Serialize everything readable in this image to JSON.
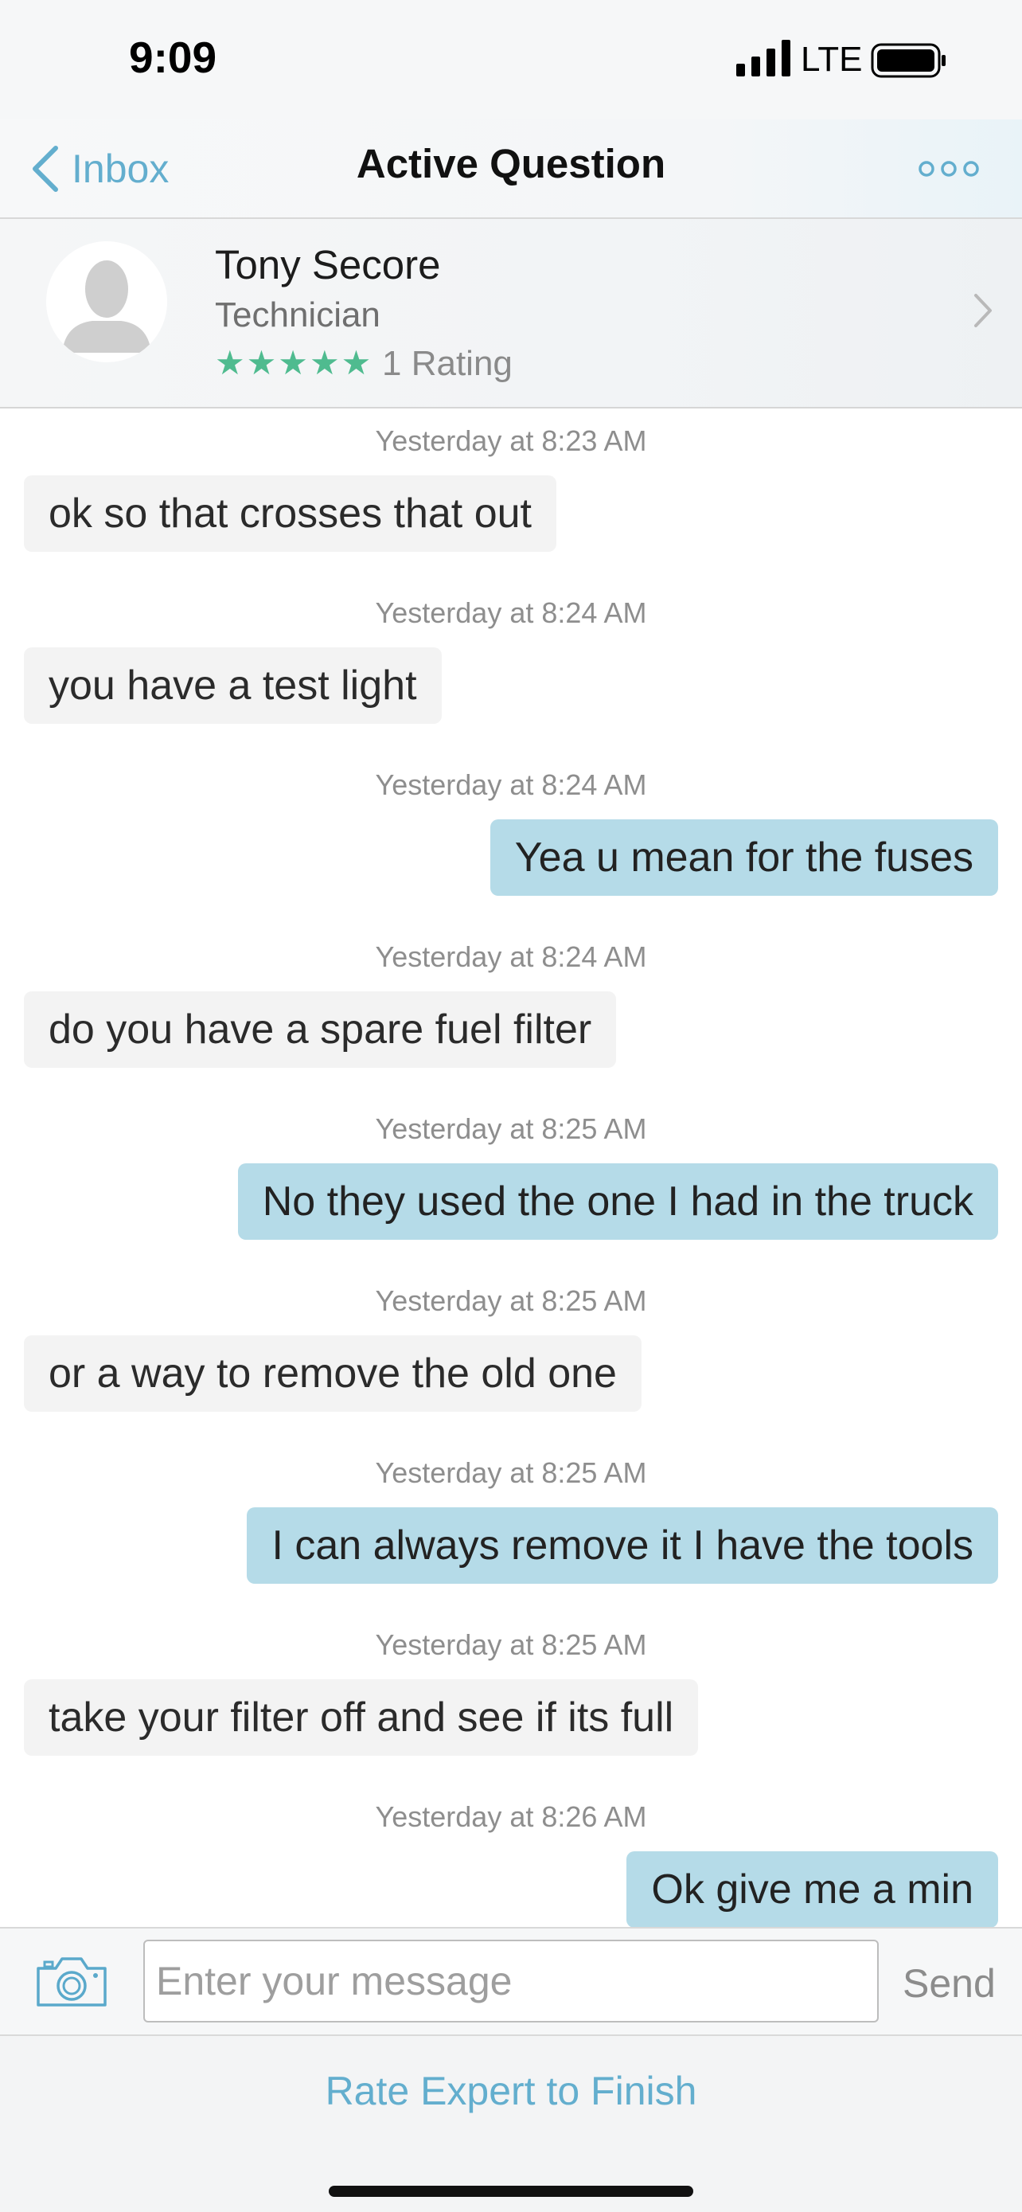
{
  "status_bar": {
    "time": "9:09",
    "network": "LTE"
  },
  "nav": {
    "back_label": "Inbox",
    "title": "Active Question",
    "more_icon": "more-dots-icon"
  },
  "expert": {
    "name": "Tony Secore",
    "role": "Technician",
    "stars": "★★★★★",
    "rating_value": 5,
    "rating_text": "1 Rating"
  },
  "messages": [
    {
      "time": "Yesterday at 8:23 AM",
      "text": "ok so that crosses that out",
      "direction": "in"
    },
    {
      "time": "Yesterday at 8:24 AM",
      "text": "you have a test light",
      "direction": "in"
    },
    {
      "time": "Yesterday at 8:24 AM",
      "text": "Yea u mean for the fuses",
      "direction": "out"
    },
    {
      "time": "Yesterday at 8:24 AM",
      "text": "do you have a spare fuel filter",
      "direction": "in"
    },
    {
      "time": "Yesterday at 8:25 AM",
      "text": "No they used the one I had in the truck",
      "direction": "out"
    },
    {
      "time": "Yesterday at 8:25 AM",
      "text": "or a way to remove the old one",
      "direction": "in"
    },
    {
      "time": "Yesterday at 8:25 AM",
      "text": "I can always remove it I have the tools",
      "direction": "out"
    },
    {
      "time": "Yesterday at 8:25 AM",
      "text": "take your filter off and see if its full",
      "direction": "in"
    },
    {
      "time": "Yesterday at 8:26 AM",
      "text": "Ok give me a min",
      "direction": "out"
    }
  ],
  "composer": {
    "placeholder": "Enter your message",
    "value": "",
    "send_label": "Send"
  },
  "footer": {
    "rate_label": "Rate Expert to Finish"
  },
  "colors": {
    "accent": "#63aece",
    "outgoing_bubble": "#b5dbe8",
    "incoming_bubble": "#f3f3f3",
    "stars": "#4fbb8f"
  }
}
